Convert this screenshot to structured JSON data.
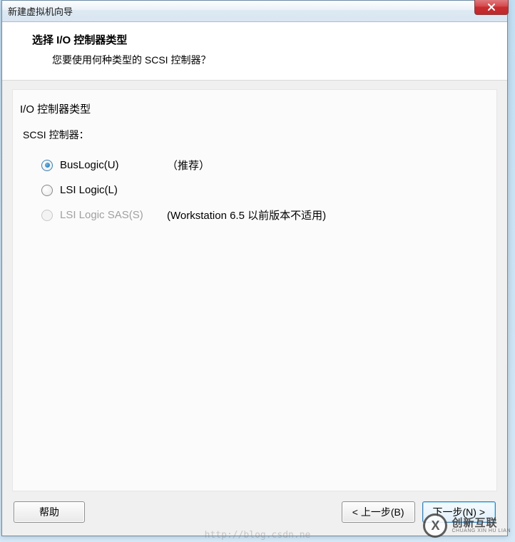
{
  "window_title": "新建虚拟机向导",
  "header": {
    "title": "选择 I/O 控制器类型",
    "subtitle": "您要使用何种类型的 SCSI 控制器？"
  },
  "content": {
    "section_label": "I/O 控制器类型",
    "group_label": "SCSI 控制器：",
    "options": [
      {
        "label": "BusLogic(U)",
        "note": "（推荐）",
        "selected": true,
        "disabled": false
      },
      {
        "label": "LSI Logic(L)",
        "note": "",
        "selected": false,
        "disabled": false
      },
      {
        "label": "LSI Logic SAS(S)",
        "note": "(Workstation 6.5 以前版本不适用)",
        "selected": false,
        "disabled": true
      }
    ]
  },
  "buttons": {
    "help": "帮助",
    "back": "< 上一步(B)",
    "next": "下一步(N) >"
  },
  "watermark": {
    "cn": "创新互联",
    "en": "CHUANG XIN HU LIAN",
    "logo_letter": "X"
  },
  "faded_url": "http://blog.csdn.ne"
}
